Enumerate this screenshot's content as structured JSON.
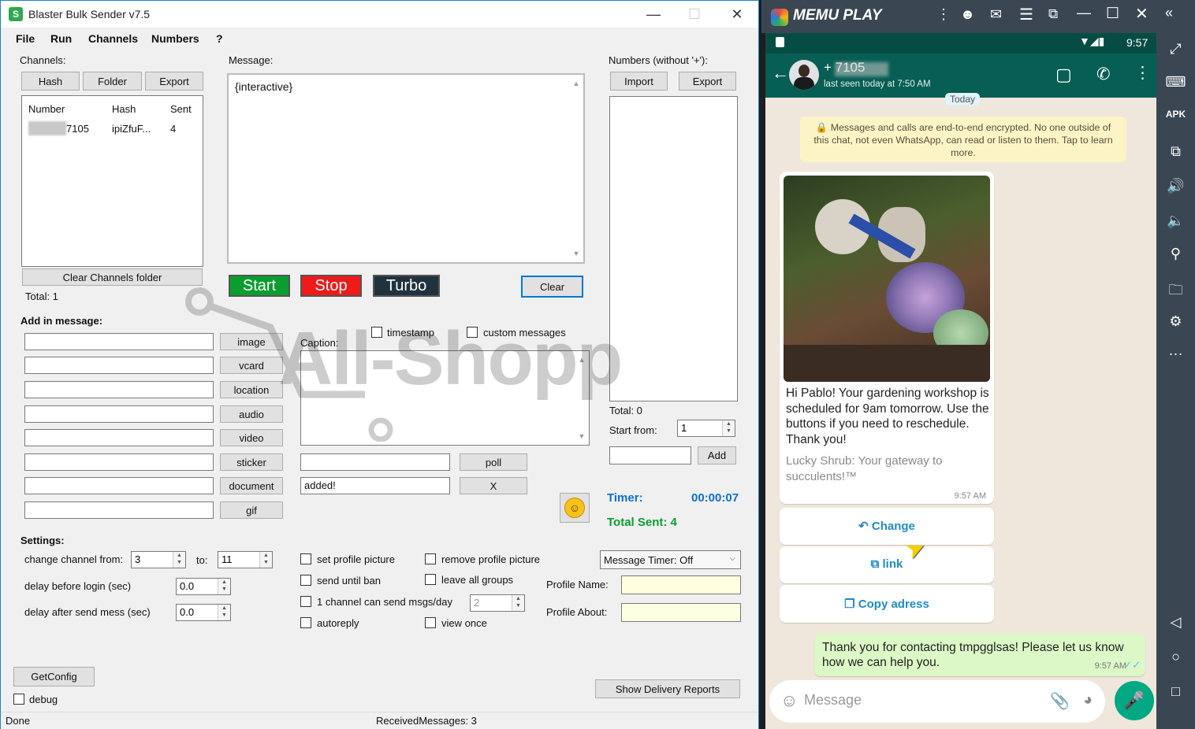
{
  "app": {
    "title": "Blaster Bulk Sender v7.5",
    "menu": [
      "File",
      "Run",
      "Channels",
      "Numbers",
      "?"
    ]
  },
  "channels": {
    "label": "Channels:",
    "buttons": [
      "Hash",
      "Folder",
      "Export"
    ],
    "columns": [
      "Number",
      "Hash",
      "Sent"
    ],
    "rows": [
      {
        "number": "7105",
        "hash": "ipiZfuF...",
        "sent": "4"
      }
    ],
    "clear_button": "Clear Channels folder",
    "total": "Total: 1"
  },
  "message": {
    "label": "Message:",
    "text": "{interactive}",
    "start": "Start",
    "stop": "Stop",
    "turbo": "Turbo",
    "clear": "Clear"
  },
  "numbers": {
    "label": "Numbers (without '+'):",
    "import": "Import",
    "export": "Export",
    "total": "Total: 0",
    "start_from_label": "Start from:",
    "start_from_value": "1",
    "add": "Add"
  },
  "add_in_message": {
    "label": "Add in message:",
    "buttons": [
      "image",
      "vcard",
      "location",
      "audio",
      "video",
      "sticker",
      "document",
      "gif"
    ],
    "timestamp": "timestamp",
    "custom_messages": "custom messages",
    "caption_label": "Caption:",
    "poll": "poll",
    "x": "X",
    "added_value": "added!"
  },
  "timer": {
    "label": "Timer:",
    "value": "00:00:07",
    "total_sent": "Total Sent: 4"
  },
  "settings": {
    "label": "Settings:",
    "change_channel_from": "change channel from:",
    "from_value": "3",
    "to_label": "to:",
    "to_value": "11",
    "delay_login": "delay before login (sec)",
    "delay_login_value": "0.0",
    "delay_send": "delay after send mess (sec)",
    "delay_send_value": "0.0",
    "set_profile_picture": "set profile picture",
    "remove_profile_picture": "remove profile picture",
    "send_until_ban": "send until ban",
    "leave_all_groups": "leave all groups",
    "one_channel": "1 channel can send msgs/day",
    "one_channel_value": "2",
    "autoreply": "autoreply",
    "view_once": "view once",
    "message_timer": "Message Timer: Off",
    "profile_name": "Profile Name:",
    "profile_about": "Profile About:",
    "getconfig": "GetConfig",
    "debug": "debug",
    "show_reports": "Show Delivery Reports"
  },
  "status": {
    "left": "Done",
    "center": "ReceivedMessages: 3"
  },
  "memu": {
    "title": "MEMU PLAY",
    "time": "9:57"
  },
  "chat": {
    "contact": "+ 7105",
    "last_seen": "last seen today at 7:50 AM",
    "today": "Today",
    "encryption": "Messages and calls are end-to-end encrypted. No one outside of this chat, not even WhatsApp, can read or listen to them. Tap to learn more.",
    "message_body": "Hi Pablo! Your gardening workshop is scheduled for 9am tomorrow. Use the buttons if you need to reschedule. Thank you!",
    "message_footer": "Lucky Shrub: Your gateway to succulents!™",
    "message_time": "9:57 AM",
    "button_change": "Change",
    "button_link": "link",
    "button_copy": "Copy adress",
    "reply_text": "Thank you for contacting tmpgglsas! Please let us know how we can help you.",
    "reply_time": "9:57 AM",
    "input_placeholder": "Message"
  },
  "watermark": "All-Shopp"
}
